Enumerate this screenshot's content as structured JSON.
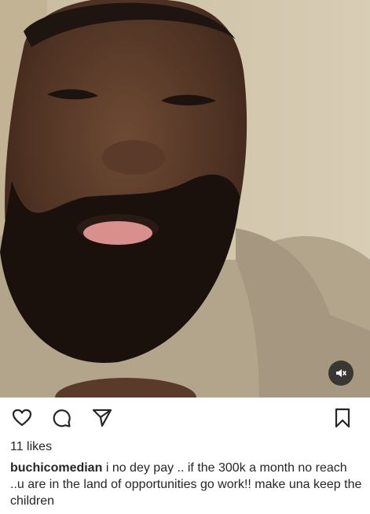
{
  "post": {
    "media": {
      "type": "video",
      "audio_icon": "speaker-muted-icon"
    },
    "actions": {
      "like_icon": "heart-icon",
      "comment_icon": "comment-icon",
      "share_icon": "send-icon",
      "save_icon": "bookmark-icon"
    },
    "likes_text": "11 likes",
    "caption": {
      "username": "buchicomedian",
      "text": "i no dey pay .. if the 300k a month no reach ..u are in the land of opportunities go work!! make una keep the children"
    }
  }
}
